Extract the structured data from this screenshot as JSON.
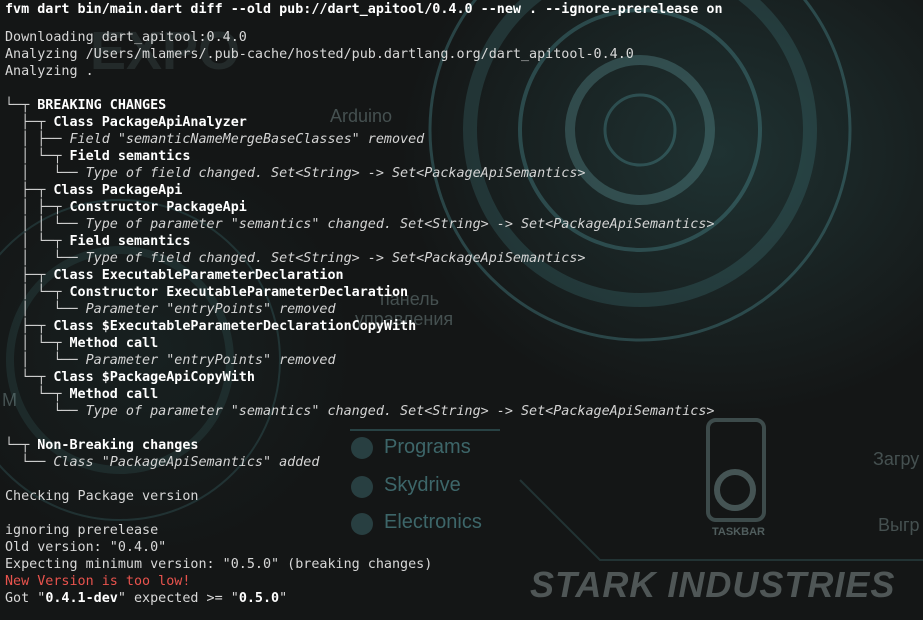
{
  "command": "fvm dart bin/main.dart diff --old pub://dart_apitool/0.4.0 --new . --ignore-prerelease on",
  "preamble": [
    "Downloading dart_apitool:0.4.0",
    "Analyzing /Users/mlamers/.pub-cache/hosted/pub.dartlang.org/dart_apitool-0.4.0",
    "Analyzing ."
  ],
  "tree": [
    {
      "prefix": "└─┬ ",
      "text": "BREAKING CHANGES",
      "style": "head"
    },
    {
      "prefix": "  ├─┬ ",
      "text": "Class PackageApiAnalyzer",
      "style": "head"
    },
    {
      "prefix": "  │ ├── ",
      "text": "Field \"semanticNameMergeBaseClasses\" removed",
      "style": "leaf"
    },
    {
      "prefix": "  │ └─┬ ",
      "text": "Field semantics",
      "style": "head"
    },
    {
      "prefix": "  │   └── ",
      "text": "Type of field changed. Set<String> -> Set<PackageApiSemantics>",
      "style": "leaf"
    },
    {
      "prefix": "  ├─┬ ",
      "text": "Class PackageApi",
      "style": "head"
    },
    {
      "prefix": "  │ ├─┬ ",
      "text": "Constructor PackageApi",
      "style": "head"
    },
    {
      "prefix": "  │ │ └── ",
      "text": "Type of parameter \"semantics\" changed. Set<String> -> Set<PackageApiSemantics>",
      "style": "leaf"
    },
    {
      "prefix": "  │ └─┬ ",
      "text": "Field semantics",
      "style": "head"
    },
    {
      "prefix": "  │   └── ",
      "text": "Type of field changed. Set<String> -> Set<PackageApiSemantics>",
      "style": "leaf"
    },
    {
      "prefix": "  ├─┬ ",
      "text": "Class ExecutableParameterDeclaration",
      "style": "head"
    },
    {
      "prefix": "  │ └─┬ ",
      "text": "Constructor ExecutableParameterDeclaration",
      "style": "head"
    },
    {
      "prefix": "  │   └── ",
      "text": "Parameter \"entryPoints\" removed",
      "style": "leaf"
    },
    {
      "prefix": "  ├─┬ ",
      "text": "Class $ExecutableParameterDeclarationCopyWith",
      "style": "head"
    },
    {
      "prefix": "  │ └─┬ ",
      "text": "Method call",
      "style": "head"
    },
    {
      "prefix": "  │   └── ",
      "text": "Parameter \"entryPoints\" removed",
      "style": "leaf"
    },
    {
      "prefix": "  └─┬ ",
      "text": "Class $PackageApiCopyWith",
      "style": "head"
    },
    {
      "prefix": "    └─┬ ",
      "text": "Method call",
      "style": "head"
    },
    {
      "prefix": "      └── ",
      "text": "Type of parameter \"semantics\" changed. Set<String> -> Set<PackageApiSemantics>",
      "style": "leaf"
    }
  ],
  "tree2": [
    {
      "prefix": "└─┬ ",
      "text": "Non-Breaking changes",
      "style": "head"
    },
    {
      "prefix": "  └── ",
      "text": "Class \"PackageApiSemantics\" added",
      "style": "leaf"
    }
  ],
  "footer": {
    "check": "Checking Package version",
    "ignoring": "ignoring prerelease",
    "old_version": "Old version: \"0.4.0\"",
    "expecting": "Expecting minimum version: \"0.5.0\" (breaking changes)",
    "error": "New Version is too low!",
    "got_prefix": "Got \"",
    "got_version": "0.4.1-dev",
    "got_mid": "\" expected >= \"",
    "expected_version": "0.5.0",
    "got_suffix": "\""
  },
  "wallpaper": {
    "arduino": "Arduino",
    "panel_1": "панель",
    "panel_2": "управления",
    "menu": [
      "Programs",
      "Skydrive",
      "Electronics"
    ],
    "taskbar": "TASKBAR",
    "zagru": "Загру",
    "vygr": "Выгр",
    "stark": "STARK INDUSTRIES",
    "expo": "EXPO",
    "m": "M"
  },
  "colors": {
    "background": "#141616",
    "text": "#dcdcdc",
    "error": "#e8534d",
    "wallpaper_accent": "#5faaaf"
  }
}
